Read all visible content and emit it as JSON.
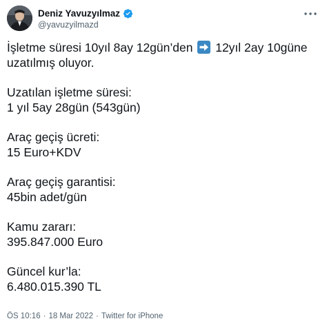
{
  "author": {
    "display_name": "Deniz Yavuzyılmaz",
    "handle": "@yavuzyilmazd",
    "verified_icon": "verified-badge-icon",
    "more_icon": "more-options-icon"
  },
  "tweet": {
    "line1_before": "İşletme süresi 10yıl 8ay 12gün’den",
    "line1_emoji": "right-arrow-emoji",
    "line1_after": "12yıl 2ay 10güne",
    "line2": "uzatılmış oluyor.",
    "sections": [
      {
        "label": "Uzatılan işletme süresi:",
        "value": "1 yıl 5ay 28gün (543gün)"
      },
      {
        "label": "Araç geçiş ücreti:",
        "value": "15 Euro+KDV"
      },
      {
        "label": "Araç geçiş garantisi:",
        "value": "45bin adet/gün"
      },
      {
        "label": "Kamu zararı:",
        "value": "395.847.000 Euro"
      },
      {
        "label": "Güncel kur’la:",
        "value": "6.480.015.390 TL"
      }
    ]
  },
  "meta": {
    "time": "ÖS 10:16",
    "separator": "·",
    "date": "18 Mar 2022",
    "source": "Twitter for iPhone"
  },
  "colors": {
    "text": "#0f1419",
    "secondary": "#536471",
    "verified": "#1d9bf0",
    "emoji_bg": "#3b88c3"
  }
}
